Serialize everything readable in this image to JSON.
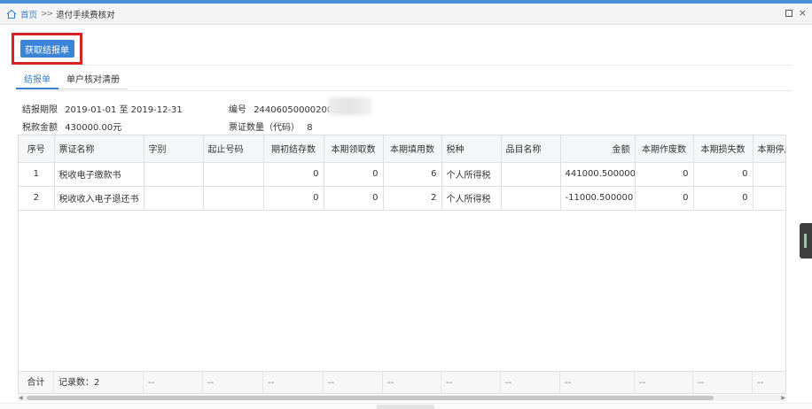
{
  "breadcrumb": {
    "home": "首页",
    "separator": ">>",
    "page": "退付手续费核对"
  },
  "window_controls": {
    "restore": "□",
    "close": "×"
  },
  "toolbar": {
    "fetch_label": "获取结报单"
  },
  "tabs": [
    {
      "label": "结报单",
      "active": true
    },
    {
      "label": "单户核对清册",
      "active": false
    }
  ],
  "info": {
    "period_label": "结报期限",
    "period_value": "2019-01-01 至 2019-12-31",
    "number_label": "编号",
    "number_value": "244060500002001",
    "tax_amount_label": "税款金额",
    "tax_amount_value": "430000.00元",
    "ticket_count_label": "票证数量（代码）",
    "ticket_count_value": "8"
  },
  "table": {
    "headers": [
      "序号",
      "票证名称",
      "字别",
      "起止号码",
      "期初结存数",
      "本期领取数",
      "本期填用数",
      "税种",
      "品目名称",
      "金额",
      "本期作废数",
      "本期损失数",
      "本期停用"
    ],
    "rows": [
      [
        "1",
        "税收电子缴款书",
        "",
        "",
        "0",
        "0",
        "6",
        "个人所得税",
        "",
        "441000.500000",
        "0",
        "0",
        ""
      ],
      [
        "2",
        "税收收入电子退还书",
        "",
        "",
        "0",
        "0",
        "2",
        "个人所得税",
        "",
        "-11000.500000",
        "0",
        "0",
        ""
      ]
    ],
    "footer": {
      "total_label": "合计",
      "record_count": "记录数：2",
      "empty_mark": "--"
    }
  },
  "colors": {
    "accent": "#3b85d8",
    "highlight_border": "#d42426"
  }
}
